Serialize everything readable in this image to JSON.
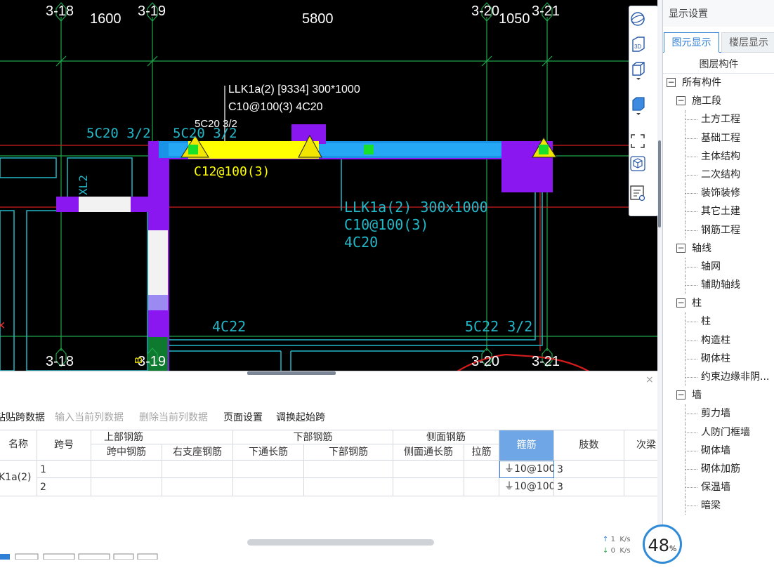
{
  "cad": {
    "axes_top": [
      "3-18",
      "3-19",
      "3-20",
      "3-21"
    ],
    "axes_bottom": [
      "3-18",
      "3-19",
      "3-20",
      "3-21"
    ],
    "dims": [
      "1600",
      "5800",
      "1050"
    ],
    "beam_label_line1": "LLK1a(2) [9334] 300*1000",
    "beam_label_line2": "C10@100(3) 4C20",
    "top_note_left": "5C20 3/2",
    "top_note_mid": "5C20 3/2",
    "top_note_small": "5C20 3/2",
    "stirrup_note": "C12@100(3)",
    "beam_tag_line1": "LLK1a(2) 300x1000",
    "beam_tag_line2": "C10@100(3)",
    "beam_tag_line3": "4C20",
    "bottom_note_left": "4C22",
    "bottom_note_right": "5C22 3/2",
    "xl_label": "XL2",
    "red_x": "×",
    "b_small": "B"
  },
  "toolbar_icons": [
    "sphere-icon",
    "3d-box-icon",
    "box-outline-icon",
    "box-filled-icon",
    "fit-view-icon",
    "view-cube-icon",
    "list-settings-icon"
  ],
  "panel": {
    "title": "显示设置",
    "tab_active": "图元显示",
    "tab_other": "楼层显示",
    "tree_header": "图层构件",
    "tree": [
      {
        "label": "所有构件",
        "level": 0,
        "box": "−"
      },
      {
        "label": "施工段",
        "level": 1,
        "box": "−"
      },
      {
        "label": "土方工程",
        "level": 2
      },
      {
        "label": "基础工程",
        "level": 2
      },
      {
        "label": "主体结构",
        "level": 2
      },
      {
        "label": "二次结构",
        "level": 2
      },
      {
        "label": "装饰装修",
        "level": 2
      },
      {
        "label": "其它土建",
        "level": 2
      },
      {
        "label": "钢筋工程",
        "level": 2
      },
      {
        "label": "轴线",
        "level": 1,
        "box": "−"
      },
      {
        "label": "轴网",
        "level": 2
      },
      {
        "label": "辅助轴线",
        "level": 2
      },
      {
        "label": "柱",
        "level": 1,
        "box": "−"
      },
      {
        "label": "柱",
        "level": 2
      },
      {
        "label": "构造柱",
        "level": 2
      },
      {
        "label": "砌体柱",
        "level": 2
      },
      {
        "label": "约束边缘非阴...",
        "level": 2
      },
      {
        "label": "墙",
        "level": 1,
        "box": "−"
      },
      {
        "label": "剪力墙",
        "level": 2
      },
      {
        "label": "人防门框墙",
        "level": 2
      },
      {
        "label": "砌体墙",
        "level": 2
      },
      {
        "label": "砌体加筋",
        "level": 2
      },
      {
        "label": "保温墙",
        "level": 2
      },
      {
        "label": "暗梁",
        "level": 2
      }
    ]
  },
  "bottom": {
    "close": "×",
    "buttons": [
      {
        "label": "粘贴跨数据",
        "enabled": true
      },
      {
        "label": "输入当前列数据",
        "enabled": false
      },
      {
        "label": "删除当前列数据",
        "enabled": false
      },
      {
        "label": "页面设置",
        "enabled": true
      },
      {
        "label": "调换起始跨",
        "enabled": true
      }
    ],
    "headers": {
      "name": "名称",
      "span": "跨号",
      "top_rebar": "上部钢筋",
      "mid_span": "跨中钢筋",
      "right_support": "右支座钢筋",
      "bottom_rebar": "下部钢筋",
      "bottom_through": "下通长筋",
      "bottom_steel": "下部钢筋",
      "side_rebar": "侧面钢筋",
      "side_through": "侧面通长筋",
      "tie": "拉筋",
      "stirrup": "箍筋",
      "legs": "肢数",
      "secondary": "次梁"
    },
    "rows": [
      {
        "span": "1",
        "stirrup": "⏚10@100",
        "legs": "3"
      },
      {
        "span": "2",
        "stirrup": "⏚10@100",
        "legs": "3"
      }
    ],
    "beam_name": "K1a(2)",
    "net_up": "1",
    "net_down": "0",
    "net_unit": "K/s",
    "percent": "48",
    "percent_unit": "%"
  }
}
